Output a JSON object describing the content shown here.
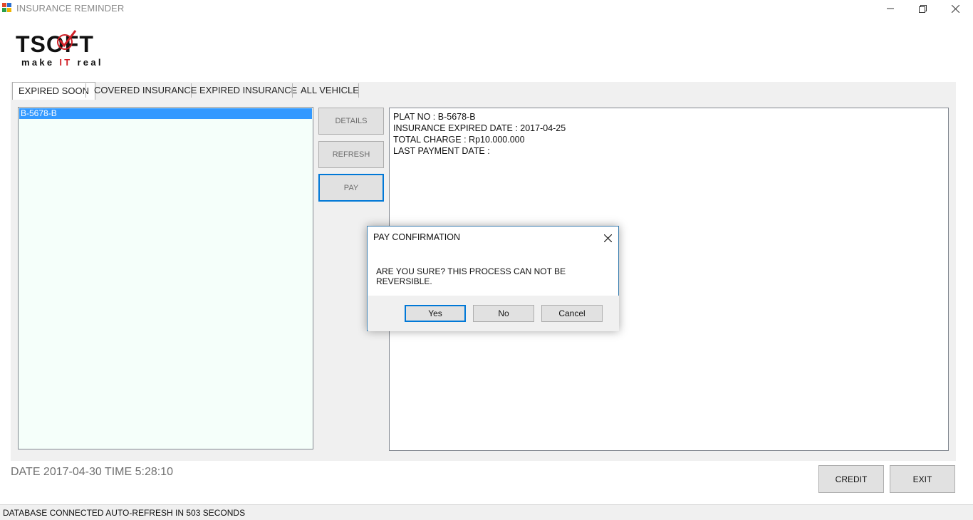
{
  "window": {
    "title": "INSURANCE REMINDER"
  },
  "logo": {
    "main": "TSOFT",
    "tag_make": "make ",
    "tag_it": "IT",
    "tag_real": " real"
  },
  "tabs": [
    {
      "label": "EXPIRED SOON",
      "active": true
    },
    {
      "label": "COVERED INSURANCE",
      "active": false
    },
    {
      "label": "EXPIRED INSURANCE",
      "active": false
    },
    {
      "label": "ALL VEHICLE",
      "active": false
    }
  ],
  "vehicle_list": {
    "items": [
      "B-5678-B"
    ],
    "selected": "B-5678-B"
  },
  "actions": {
    "details": "DETAILS",
    "refresh": "REFRESH",
    "pay": "PAY"
  },
  "details": {
    "line1": "PLAT NO : B-5678-B",
    "line2": "INSURANCE EXPIRED DATE : 2017-04-25",
    "line3": "TOTAL CHARGE : Rp10.000.000",
    "line4": "LAST PAYMENT DATE :"
  },
  "footer": {
    "datetime": "DATE 2017-04-30 TIME 5:28:10",
    "credit": "CREDIT",
    "exit": "EXIT"
  },
  "status": {
    "text": "DATABASE CONNECTED AUTO-REFRESH IN 503 SECONDS"
  },
  "dialog": {
    "title": "PAY CONFIRMATION",
    "message": "ARE YOU SURE? THIS PROCESS CAN NOT BE REVERSIBLE.",
    "yes": "Yes",
    "no": "No",
    "cancel": "Cancel"
  },
  "colors": {
    "accent": "#0078d7",
    "selection": "#3399ff",
    "list_bg": "#f5fffa",
    "logo_red": "#d01f26"
  }
}
